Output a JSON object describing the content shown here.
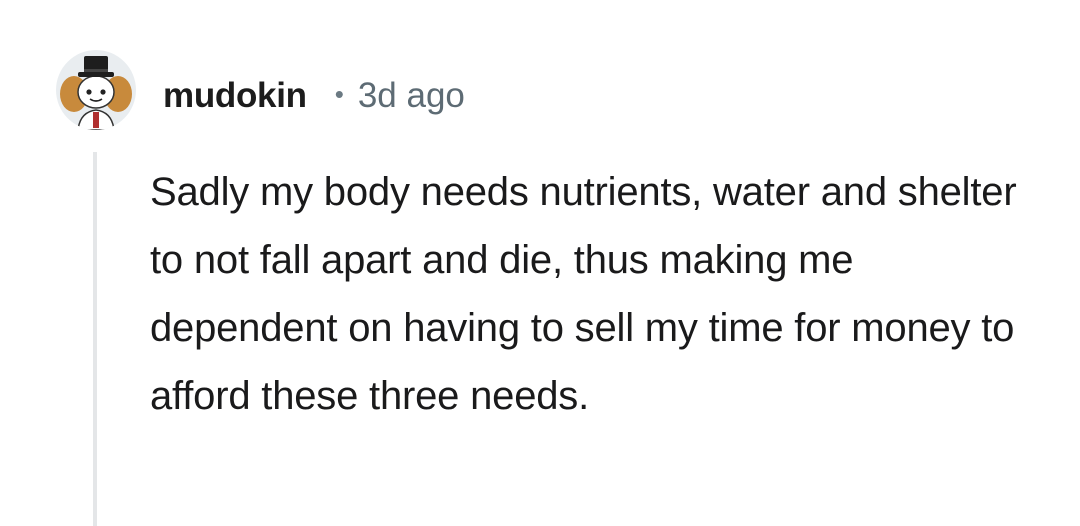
{
  "comment": {
    "author": "mudokin",
    "separator": "•",
    "age": "3d ago",
    "body": "Sadly my body needs nutrients, water and shelter to not fall apart and die, thus making me dependent on having to sell my time for money to afford these three needs."
  },
  "colors": {
    "username": "#1c1c1c",
    "meta": "#5d6b74",
    "body_text": "#1a1a1b",
    "thread_line": "#e4e6e8",
    "avatar_background": "#e9edf0"
  },
  "icons": {
    "avatar": "snoo-avatar-with-top-hat"
  }
}
